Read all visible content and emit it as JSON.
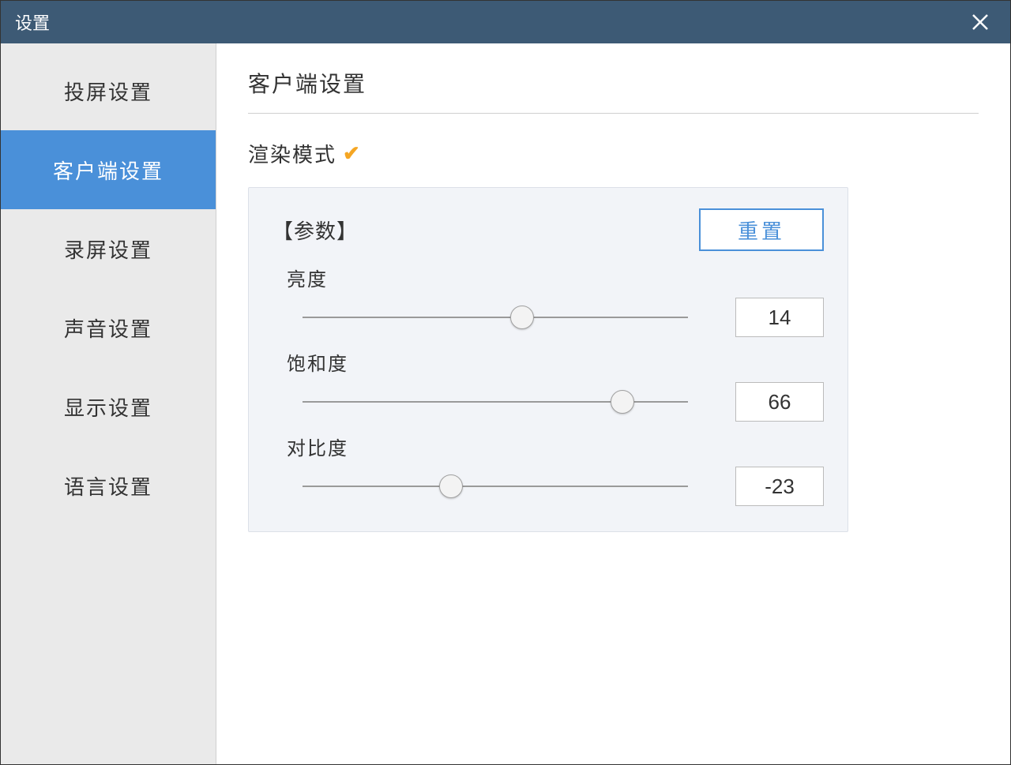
{
  "window": {
    "title": "设置"
  },
  "sidebar": {
    "items": [
      {
        "label": "投屏设置"
      },
      {
        "label": "客户端设置"
      },
      {
        "label": "录屏设置"
      },
      {
        "label": "声音设置"
      },
      {
        "label": "显示设置"
      },
      {
        "label": "语言设置"
      }
    ],
    "active_index": 1
  },
  "content": {
    "title": "客户端设置",
    "render_mode_label": "渲染模式",
    "params_label": "【参数】",
    "reset_label": "重置",
    "sliders": [
      {
        "label": "亮度",
        "value": "14",
        "position_percent": 57
      },
      {
        "label": "饱和度",
        "value": "66",
        "position_percent": 83
      },
      {
        "label": "对比度",
        "value": "-23",
        "position_percent": 38.5
      }
    ]
  }
}
